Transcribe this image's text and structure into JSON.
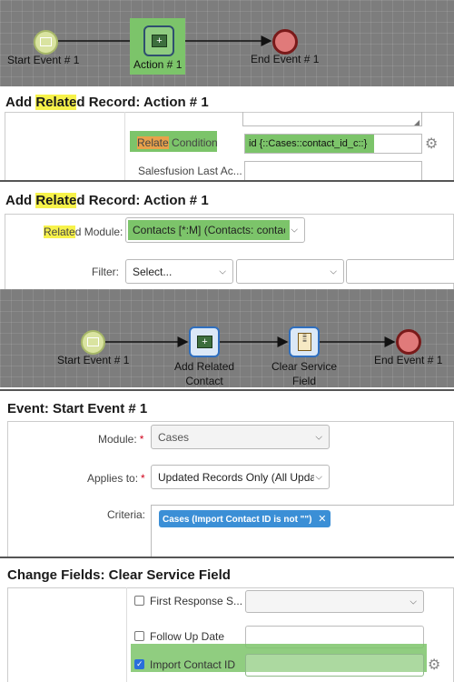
{
  "colors": {
    "highlight_yellow": "#f7f24a",
    "highlight_green": "#7cc46a",
    "tag_blue": "#3b8fd6",
    "checkbox_blue": "#2a6fdb",
    "required_red": "#d0021b"
  },
  "flow1": {
    "start": "Start Event # 1",
    "action": "Action # 1",
    "end": "End Event # 1"
  },
  "panel1": {
    "title_pre": "Add ",
    "title_hl": "Relate",
    "title_post": "d Record: Action # 1",
    "condition_hl": "Relate",
    "condition_rest": " Condition",
    "condition_value": "id {::Cases::contact_id_c::}",
    "last_label": "Salesfusion Last Ac..."
  },
  "panel2": {
    "title_pre": "Add ",
    "title_hl": "Relate",
    "title_post": "d Record: Action # 1",
    "module_label_hl": "Relate",
    "module_label_rest": "d Module:",
    "module_value": "Contacts [*:M] (Contacts: contac",
    "filter_label": "Filter:",
    "filter_select": "Select..."
  },
  "flow2": {
    "start": "Start Event # 1",
    "add_l1": "Add Related",
    "add_l2": "Contact",
    "clear_l1": "Clear Service",
    "clear_l2": "Field",
    "end": "End Event # 1"
  },
  "panel3": {
    "title": "Event: Start Event # 1",
    "module_label": "Module:",
    "module_value": "Cases",
    "applies_label": "Applies to:",
    "applies_value": "Updated Records Only (All Updat",
    "criteria_label": "Criteria:",
    "criteria_tag": "Cases (Import Contact ID is not \"\")",
    "required_mark": "*"
  },
  "panel4": {
    "title": "Change Fields: Clear Service Field",
    "first_response": "First Response S...",
    "follow_up": "Follow Up Date",
    "import_contact": "Import Contact ID"
  }
}
